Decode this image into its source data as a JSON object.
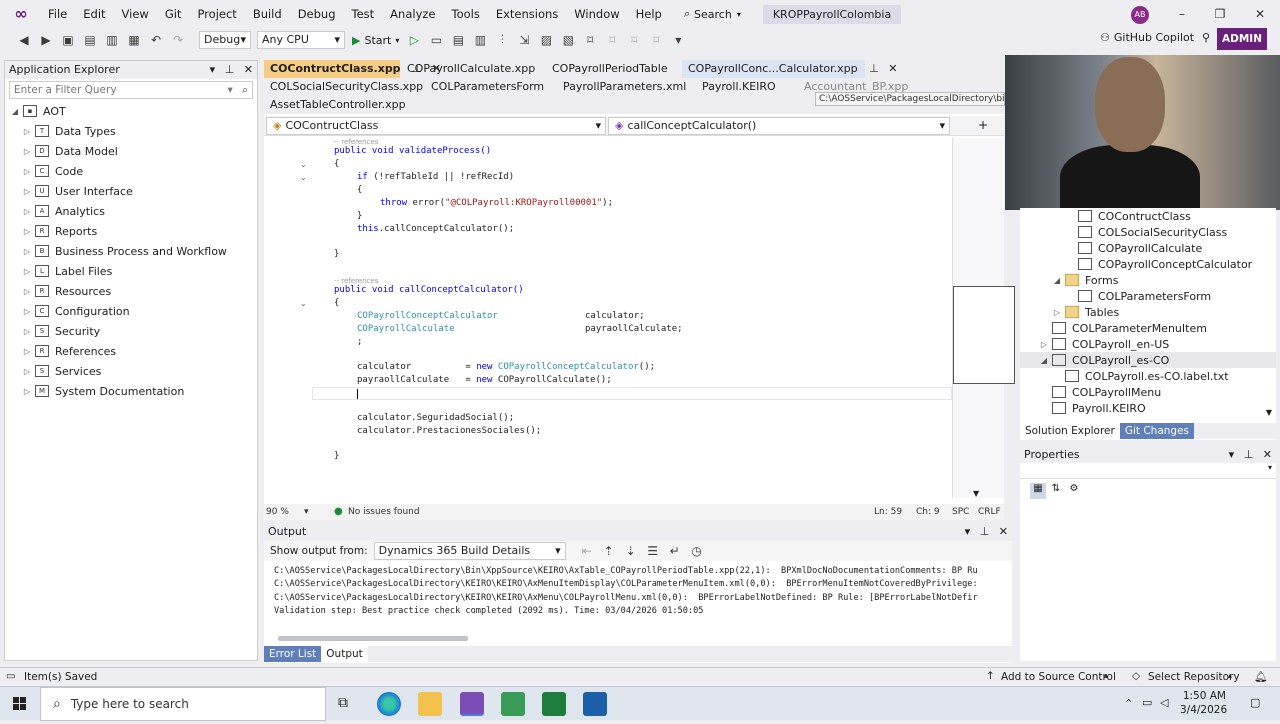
{
  "menu": [
    "File",
    "Edit",
    "View",
    "Git",
    "Project",
    "Build",
    "Debug",
    "Test",
    "Analyze",
    "Tools",
    "Extensions",
    "Window",
    "Help"
  ],
  "search_label": "Search",
  "solution_title": "KROPPayrollColombia",
  "avatar_initials": "AB",
  "toolbar": {
    "config": "Debug",
    "platform": "Any CPU",
    "start": "Start",
    "copilot": "GitHub Copilot",
    "admin": "ADMIN"
  },
  "app_explorer": {
    "title": "Application Explorer",
    "filter_placeholder": "Enter a Filter Query",
    "root": "AOT",
    "items": [
      "Data Types",
      "Data Model",
      "Code",
      "User Interface",
      "Analytics",
      "Reports",
      "Business Process and Workflow",
      "Label Files",
      "Resources",
      "Configuration",
      "Security",
      "References",
      "Services",
      "System Documentation"
    ]
  },
  "tabs": {
    "row1": [
      "COContructClass.xpp",
      "COPayrollCalculate.xpp",
      "COPayrollPeriodTable",
      "COPayrollConc...Calculator.xpp"
    ],
    "row2": [
      "COLSocialSecurityClass.xpp",
      "COLParametersForm",
      "PayrollParameters.xml",
      "Payroll.KEIRO",
      "Accountant_BP.xpp"
    ],
    "row3": [
      "AssetTableController.xpp"
    ],
    "tooltip": "C:\\AOSService\\PackagesLocalDirectory\\bin"
  },
  "navbar": {
    "class": "COContructClass",
    "method": "callConceptCalculator()"
  },
  "code": {
    "refs": "-- references",
    "m1_decl": "public void validateProcess()",
    "m1_if_kw": "if",
    "m1_if": " (!refTableId || !refRecId)",
    "m1_throw_kw": "throw",
    "m1_throw_a": " error(",
    "m1_throw_str": "\"@COLPayroll:KROPayroll00001\"",
    "m1_throw_b": ");",
    "m1_this_kw": "this",
    "m1_this": ".callConceptCalculator();",
    "m2_decl": "public void callConceptCalculator()",
    "d1_type": "COPayrollConceptCalculator",
    "d1_var": "calculator;",
    "d2_type": "COPayrollCalculate",
    "d2_var": "payraollCalculate;",
    "semi": ";",
    "a1_lhs": "calculator          = ",
    "a1_new": "new",
    "a1_type": "COPayrollConceptCalculator",
    "a1_end": "();",
    "a2_lhs": "payraollCalculate   = ",
    "a2_new": "new",
    "a2_type": "COPayrollCalculate",
    "a2_end": "();",
    "call1": "calculator.SeguridadSocial();",
    "call2": "calculator.PrestacionesSociales();",
    "brace_open": "{",
    "brace_close": "}"
  },
  "editor_status": {
    "zoom": "90 %",
    "issues": "No issues found",
    "ln": "Ln: 59",
    "ch": "Ch: 9",
    "spc": "SPC",
    "crlf": "CRLF"
  },
  "output": {
    "title": "Output",
    "show_from": "Show output from:",
    "source": "Dynamics 365 Build Details",
    "lines": [
      "C:\\AOSService\\PackagesLocalDirectory\\Bin\\XppSource\\KEIRO\\AxTable_COPayrollPeriodTable.xpp(22,1):  BPXmlDocNoDocumentationComments: BP Ru",
      "C:\\AOSService\\PackagesLocalDirectory\\KEIRO\\KEIRO\\AxMenuItemDisplay\\COLParameterMenuItem.xml(0,0):  BPErrorMenuItemNotCoveredByPrivilege:",
      "C:\\AOSService\\PackagesLocalDirectory\\KEIRO\\KEIRO\\AxMenu\\COLPayrollMenu.xml(0,0):  BPErrorLabelNotDefined: BP Rule: [BPErrorLabelNotDefir",
      "Validation step: Best practice check completed (2092 ms). Time: 03/04/2026 01:50:05"
    ]
  },
  "bottom_tabs": [
    "Error List",
    "Output"
  ],
  "solution_explorer": {
    "items": [
      {
        "label": "COContructClass",
        "level": 4,
        "exp": "",
        "icon": "file"
      },
      {
        "label": "COLSocialSecurityClass",
        "level": 4,
        "exp": "",
        "icon": "file"
      },
      {
        "label": "COPayrollCalculate",
        "level": 4,
        "exp": "",
        "icon": "file"
      },
      {
        "label": "COPayrollConceptCalculator",
        "level": 4,
        "exp": "",
        "icon": "file"
      },
      {
        "label": "Forms",
        "level": 3,
        "exp": "◢",
        "icon": "folder"
      },
      {
        "label": "COLParametersForm",
        "level": 4,
        "exp": "",
        "icon": "file"
      },
      {
        "label": "Tables",
        "level": 3,
        "exp": "▷",
        "icon": "folder"
      },
      {
        "label": "COLParameterMenuItem",
        "level": 2,
        "exp": "",
        "icon": "file"
      },
      {
        "label": "COLPayroll_en-US",
        "level": 2,
        "exp": "▷",
        "icon": "file"
      },
      {
        "label": "COLPayroll_es-CO",
        "level": 2,
        "exp": "◢",
        "icon": "file"
      },
      {
        "label": "COLPayroll.es-CO.label.txt",
        "level": 3,
        "exp": "",
        "icon": "file"
      },
      {
        "label": "COLPayrollMenu",
        "level": 2,
        "exp": "",
        "icon": "file"
      },
      {
        "label": "Payroll.KEIRO",
        "level": 2,
        "exp": "",
        "icon": "file"
      }
    ],
    "tabs": [
      "Solution Explorer",
      "Git Changes"
    ]
  },
  "properties": {
    "title": "Properties"
  },
  "status_bar": {
    "saved": "Item(s) Saved",
    "source_control": "Add to Source Control",
    "repo": "Select Repository"
  },
  "taskbar": {
    "search_placeholder": "Type here to search",
    "time": "1:50 AM",
    "date": "3/4/2026"
  },
  "colors": {
    "accent": "#68217a",
    "active_tab": "#f5cc84",
    "keyword": "#0000ff",
    "type": "#2b91af",
    "string": "#a31515"
  }
}
